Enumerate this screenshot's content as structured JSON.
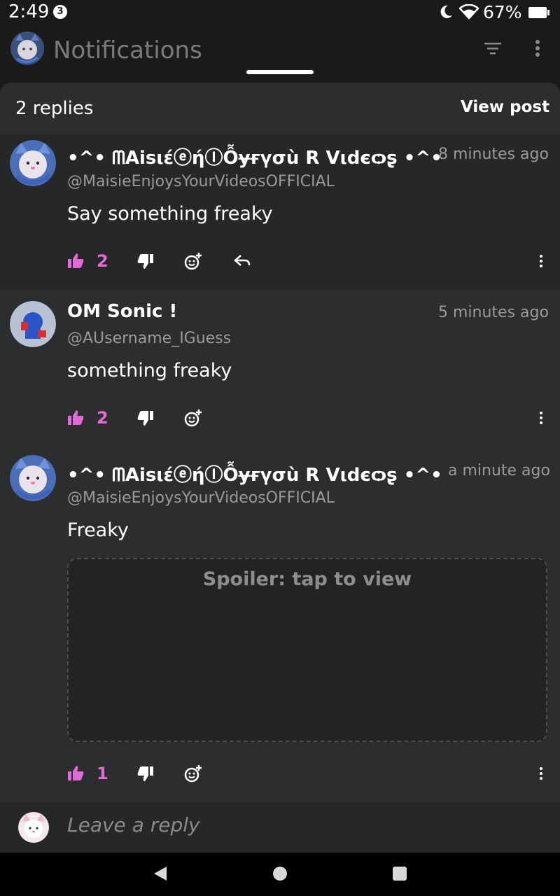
{
  "status_bar": {
    "time": "2:49",
    "notification_count": "3",
    "battery": "67%"
  },
  "header": {
    "title": "Notifications",
    "icons": [
      "filter-icon",
      "more-vert-icon"
    ]
  },
  "sheet": {
    "replies_count": "2 replies",
    "view_post_label": "View post"
  },
  "comments": [
    {
      "author": "•^• ᗰAisιέⓔήⒾỖɏғүσù R Vιdєѻʂ •^•",
      "handle": "@MaisieEnjoysYourVideosOFFICIAL",
      "time": "8 minutes ago",
      "text": "Say something freaky",
      "likes": "2",
      "liked": true,
      "has_reply_action": true
    },
    {
      "author": "OM Sonic !",
      "handle": "@AUsername_IGuess",
      "time": "5 minutes ago",
      "text": "something freaky",
      "likes": "2",
      "liked": true,
      "has_reply_action": false
    },
    {
      "author": "•^• ᗰAisιέⓔήⒾỖɏғүσù R Vιdєѻʂ •^•",
      "handle": "@MaisieEnjoysYourVideosOFFICIAL",
      "time": "a minute ago",
      "text": "Freaky",
      "spoiler_label": "Spoiler: tap to view",
      "likes": "1",
      "liked": true,
      "has_reply_action": false
    }
  ],
  "reply_bar": {
    "placeholder": "Leave a reply"
  },
  "colors": {
    "accent_pink": "#e06ad6",
    "background": "#1a1a1a",
    "card": "#2c2d2f"
  }
}
